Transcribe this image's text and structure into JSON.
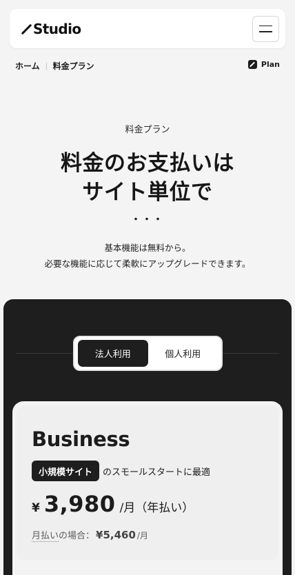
{
  "header": {
    "logo_text": "Studio",
    "menu_icon": "hamburger-icon"
  },
  "breadcrumb": {
    "items": [
      "ホーム",
      "料金プラン"
    ]
  },
  "plan_link": {
    "label": "Plan",
    "icon": "edit-icon"
  },
  "hero": {
    "eyebrow": "料金プラン",
    "title_line1": "料金のお支払いは",
    "title_line2": "サイト単位で",
    "dots": "・・・",
    "lead_line1": "基本機能は無料から。",
    "lead_line2": "必要な機能に応じて柔軟にアップグレードできます。"
  },
  "plan_toggle": {
    "options": [
      "法人利用",
      "個人利用"
    ],
    "selected": "法人利用"
  },
  "plan_card": {
    "name": "Business",
    "badge": "小規模サイト",
    "tagline": "のスモールスタートに最適",
    "currency": "¥",
    "price": "3,980",
    "price_unit": "/月（年払い）",
    "monthly_label": "月払い",
    "monthly_label_suffix": "の場合：",
    "monthly_price": "¥5,460",
    "monthly_unit": "/月"
  },
  "colors": {
    "background": "#f4f4f4",
    "dark_panel": "#1e1e1e",
    "card": "#efefef"
  }
}
